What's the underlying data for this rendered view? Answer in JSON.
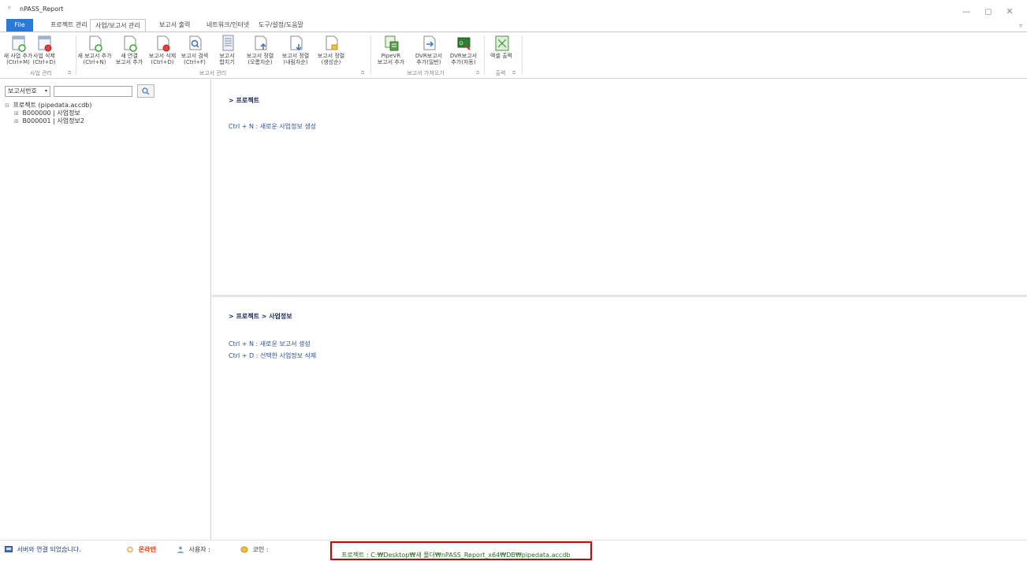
{
  "window": {
    "title": "nPASS_Report",
    "minimize": "—",
    "restore": "◻",
    "close": "✕"
  },
  "ribbon_tabs": [
    "File",
    "프로젝트 관리",
    "사업/보고서 관리",
    "보고서 출력",
    "네트워크/인터넷",
    "도구/설정/도움말"
  ],
  "ribbon_option_icon": "▿",
  "ribbon": {
    "buttons": [
      {
        "label": "새 사업 추가\n(Ctrl+M)",
        "icon": "doc-add-icon"
      },
      {
        "label": "사업 삭제\n(Ctrl+D)",
        "icon": "doc-delete-icon"
      },
      {
        "label": "새 보고서 추가\n(Ctrl+N)",
        "icon": "doc-add-icon"
      },
      {
        "label": "새 연결\n보고서 추가",
        "icon": "doc-add-icon"
      },
      {
        "label": "보고서 삭제\n(Ctrl+D)",
        "icon": "doc-delete-icon"
      },
      {
        "label": "보고서 검색\n(Ctrl+F)",
        "icon": "doc-search-icon"
      },
      {
        "label": "보고서\n합치기",
        "icon": "doc-merge-icon"
      },
      {
        "label": "보고서 정렬\n(오름차순)",
        "icon": "sort-asc-icon"
      },
      {
        "label": "보고서 정렬\n(내림차순)",
        "icon": "sort-desc-icon"
      },
      {
        "label": "보고서 정렬\n(생성순)",
        "icon": "sort-created-icon"
      },
      {
        "label": "PipeVR\n보고서 추가",
        "icon": "pipevr-icon"
      },
      {
        "label": "DVR보고서\n추가(일반)",
        "icon": "dvr-import-icon"
      },
      {
        "label": "DVR보고서\n추가(자동)",
        "icon": "dvr-auto-icon"
      },
      {
        "label": "엑셀 출력",
        "icon": "excel-export-icon"
      }
    ],
    "groups": [
      "사업 관리",
      "보고서 관리",
      "보고서 가져오기",
      "출력"
    ]
  },
  "left_panel": {
    "combo_value": "보고서번호",
    "combo_arrow": "▾",
    "search_value": "",
    "search_icon": "🔍",
    "tree": [
      {
        "label": "프로젝트 (pipedata.accdb)",
        "expander": "⊟"
      },
      {
        "label": "B000000 | 사업정보",
        "expander": "⊞"
      },
      {
        "label": "B000001 | 사업정보2",
        "expander": "⊞"
      }
    ]
  },
  "pane_top": {
    "heading": "> 프로젝트",
    "hints": [
      "Ctrl + N : 새로운 사업정보 생성"
    ]
  },
  "pane_bottom": {
    "heading": "> 프로젝트 > 사업정보",
    "hints": [
      "Ctrl + N : 새로운 보고서 생성",
      "Ctrl + D : 선택한 사업정보 삭제"
    ]
  },
  "status": {
    "connection": "서버와 연결 되었습니다.",
    "online": "온라인",
    "user": "사용자 :",
    "coin": "코인 :",
    "path": "프로젝트 : C:₩Desktop₩새 폴더₩nPASS_Report_x64₩DB₩pipedata.accdb"
  },
  "colors": {
    "file_tab": "#2b79d6",
    "highlight_box": "#d10000",
    "hint_text": "#2a4f9a",
    "online": "#e03c00"
  }
}
